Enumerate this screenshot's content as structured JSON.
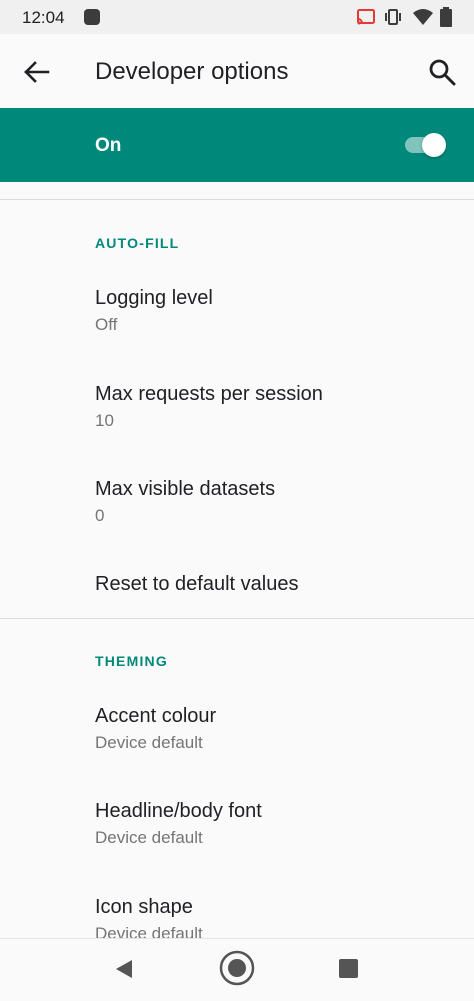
{
  "status_bar": {
    "time": "12:04",
    "icons": [
      "cast-icon",
      "vibrate-icon",
      "wifi-icon",
      "battery-icon"
    ]
  },
  "app_bar": {
    "title": "Developer options",
    "back_icon": "arrow-left-icon",
    "search_icon": "search-icon"
  },
  "master_switch": {
    "label": "On",
    "checked": true
  },
  "sections": [
    {
      "header": "AUTO-FILL",
      "items": [
        {
          "title": "Logging level",
          "summary": "Off"
        },
        {
          "title": "Max requests per session",
          "summary": "10"
        },
        {
          "title": "Max visible datasets",
          "summary": "0"
        },
        {
          "title": "Reset to default values",
          "summary": ""
        }
      ]
    },
    {
      "header": "THEMING",
      "items": [
        {
          "title": "Accent colour",
          "summary": "Device default"
        },
        {
          "title": "Headline/body font",
          "summary": "Device default"
        },
        {
          "title": "Icon shape",
          "summary": "Device default"
        }
      ]
    }
  ],
  "colors": {
    "accent": "#00897b",
    "background": "#fafafa",
    "status_bar": "#f0f0f0"
  }
}
